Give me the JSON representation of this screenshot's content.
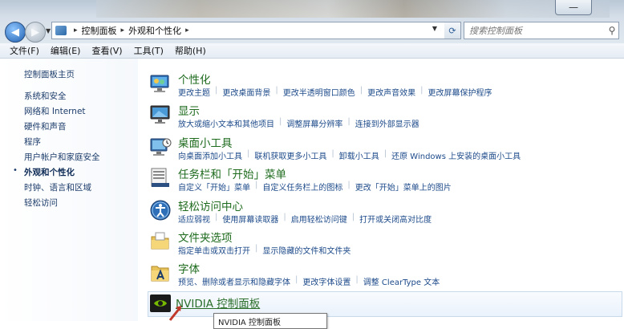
{
  "window": {
    "minimize_glyph": "—",
    "address": {
      "crumbs": [
        "控制面板",
        "外观和个性化"
      ],
      "separator": "▸"
    },
    "search_placeholder": "搜索控制面板",
    "icons": [
      "back-arrow-icon",
      "forward-arrow-icon",
      "refresh-icon",
      "search-icon",
      "control-panel-icon"
    ]
  },
  "menu": [
    "文件(F)",
    "编辑(E)",
    "查看(V)",
    "工具(T)",
    "帮助(H)"
  ],
  "sidebar": {
    "home": "控制面板主页",
    "items": [
      {
        "label": "系统和安全",
        "active": false
      },
      {
        "label": "网络和 Internet",
        "active": false
      },
      {
        "label": "硬件和声音",
        "active": false
      },
      {
        "label": "程序",
        "active": false
      },
      {
        "label": "用户帐户和家庭安全",
        "active": false
      },
      {
        "label": "外观和个性化",
        "active": true
      },
      {
        "label": "时钟、语言和区域",
        "active": false
      },
      {
        "label": "轻松访问",
        "active": false
      }
    ],
    "active_bullet": "•"
  },
  "categories": [
    {
      "title": "个性化",
      "icon": "personalization-icon",
      "links": [
        "更改主题",
        "更改桌面背景",
        "更改半透明窗口颜色",
        "更改声音效果",
        "更改屏幕保护程序"
      ]
    },
    {
      "title": "显示",
      "icon": "display-icon",
      "links": [
        "放大或缩小文本和其他项目",
        "调整屏幕分辨率",
        "连接到外部显示器"
      ]
    },
    {
      "title": "桌面小工具",
      "icon": "gadgets-icon",
      "links": [
        "向桌面添加小工具",
        "联机获取更多小工具",
        "卸载小工具",
        "还原 Windows 上安装的桌面小工具"
      ]
    },
    {
      "title": "任务栏和「开始」菜单",
      "icon": "taskbar-icon",
      "links": [
        "自定义「开始」菜单",
        "自定义任务栏上的图标",
        "更改「开始」菜单上的图片"
      ]
    },
    {
      "title": "轻松访问中心",
      "icon": "ease-of-access-icon",
      "links": [
        "适应弱视",
        "使用屏幕读取器",
        "启用轻松访问键",
        "打开或关闭高对比度"
      ]
    },
    {
      "title": "文件夹选项",
      "icon": "folder-options-icon",
      "links": [
        "指定单击或双击打开",
        "显示隐藏的文件和文件夹"
      ]
    },
    {
      "title": "字体",
      "icon": "fonts-icon",
      "links": [
        "预览、删除或者显示和隐藏字体",
        "更改字体设置",
        "调整 ClearType 文本"
      ]
    }
  ],
  "nvidia": {
    "title": "NVIDIA 控制面板",
    "icon": "nvidia-icon",
    "tooltip": "NVIDIA 控制面板"
  },
  "colors": {
    "link": "#1d4a8a",
    "category_title": "#1e6b1e",
    "arrow": "#c0392b"
  }
}
